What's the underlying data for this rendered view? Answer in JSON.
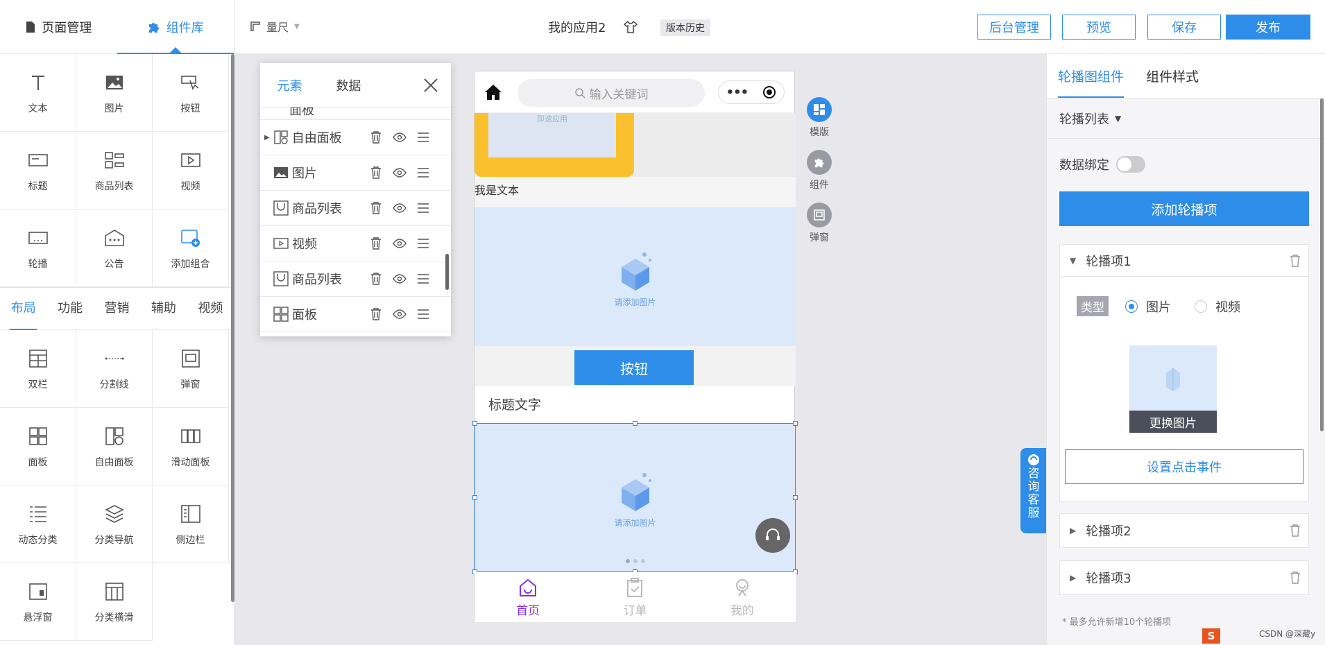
{
  "left_tabs": {
    "page_mgmt": "页面管理",
    "comp_lib": "组件库"
  },
  "toolbar": {
    "ruler": "量尺",
    "app_name": "我的应用2",
    "version_history": "版本历史",
    "backend": "后台管理",
    "preview": "预览",
    "save": "保存",
    "publish": "发布"
  },
  "components_basic": [
    {
      "label": "文本",
      "icon": "text-icon"
    },
    {
      "label": "图片",
      "icon": "image-icon"
    },
    {
      "label": "按钮",
      "icon": "button-icon"
    },
    {
      "label": "标题",
      "icon": "title-icon"
    },
    {
      "label": "商品列表",
      "icon": "product-list-icon"
    },
    {
      "label": "视频",
      "icon": "video-icon"
    },
    {
      "label": "轮播",
      "icon": "carousel-icon"
    },
    {
      "label": "公告",
      "icon": "notice-icon"
    },
    {
      "label": "添加组合",
      "icon": "add-group-icon"
    }
  ],
  "categories": [
    "布局",
    "功能",
    "营销",
    "辅助",
    "视频"
  ],
  "components_layout": [
    {
      "label": "双栏",
      "icon": "two-column-icon"
    },
    {
      "label": "分割线",
      "icon": "divider-icon"
    },
    {
      "label": "弹窗",
      "icon": "popup-icon"
    },
    {
      "label": "面板",
      "icon": "panel-icon"
    },
    {
      "label": "自由面板",
      "icon": "free-panel-icon"
    },
    {
      "label": "滑动面板",
      "icon": "slide-panel-icon"
    },
    {
      "label": "动态分类",
      "icon": "dynamic-category-icon"
    },
    {
      "label": "分类导航",
      "icon": "category-nav-icon"
    },
    {
      "label": "侧边栏",
      "icon": "sidebar-icon"
    },
    {
      "label": "悬浮窗",
      "icon": "float-window-icon"
    },
    {
      "label": "分类横滑",
      "icon": "category-scroll-icon"
    }
  ],
  "popup": {
    "tab_elements": "元素",
    "tab_data": "数据",
    "partial_top": "面板",
    "rows": [
      "自由面板",
      "图片",
      "商品列表",
      "视频",
      "商品列表",
      "面板"
    ]
  },
  "phone": {
    "search_placeholder": "输入关键词",
    "notice_caption": "即速应用",
    "text": "我是文本",
    "img_placeholder": "请添加图片",
    "button": "按钮",
    "title": "标题文字",
    "tabs": [
      {
        "label": "首页",
        "icon": "home-icon"
      },
      {
        "label": "订单",
        "icon": "order-icon"
      },
      {
        "label": "我的",
        "icon": "profile-icon"
      }
    ]
  },
  "side_buttons": {
    "template": "模版",
    "component": "组件",
    "popup": "弹窗"
  },
  "support_tab": "咨询客服",
  "right": {
    "tab_carousel": "轮播图组件",
    "tab_style": "组件样式",
    "section": "轮播列表",
    "data_binding": "数据绑定",
    "add_item": "添加轮播项",
    "item1": "轮播项1",
    "type_label": "类型",
    "type_image": "图片",
    "type_video": "视频",
    "change_image": "更换图片",
    "set_click": "设置点击事件",
    "item2": "轮播项2",
    "item3": "轮播项3",
    "note": "* 最多允许新增10个轮播项"
  },
  "watermark": "CSDN @深藏y",
  "accent": "#2e8de8"
}
